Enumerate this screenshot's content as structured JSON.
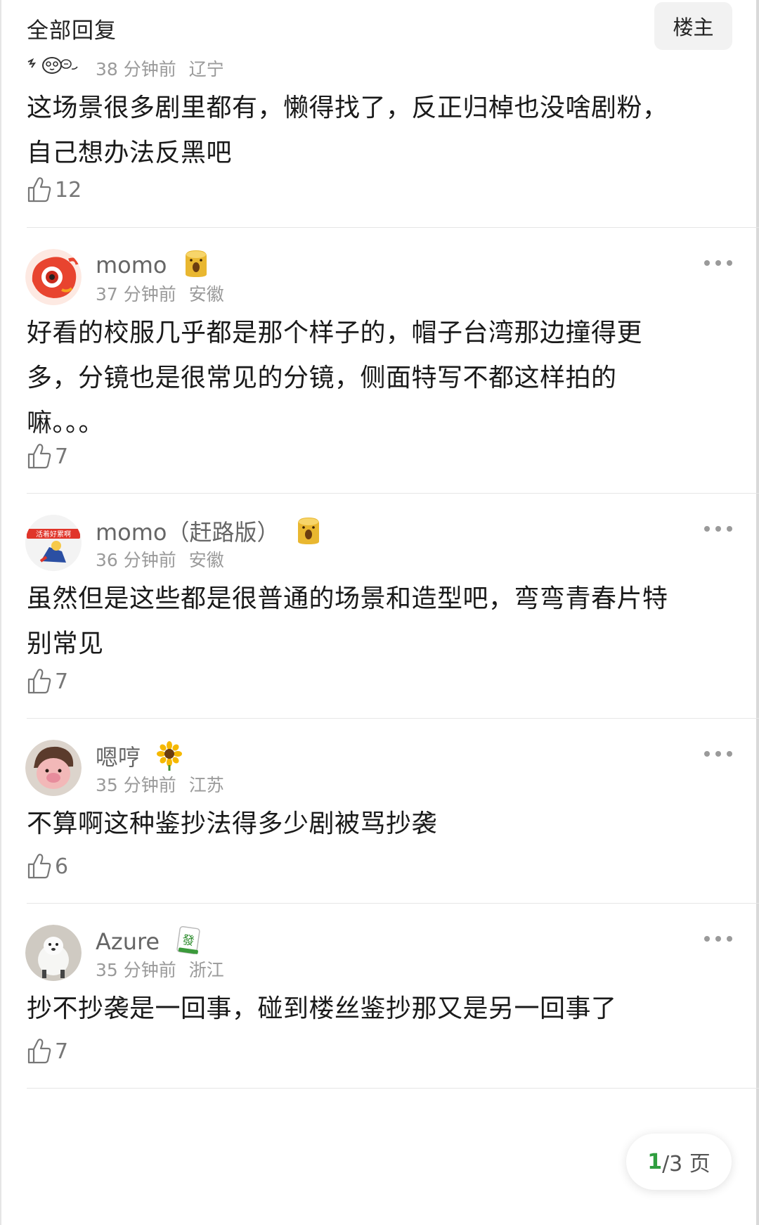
{
  "header": {
    "title": "全部回复",
    "op_button": "楼主"
  },
  "comments": [
    {
      "username": "",
      "time": "38 分钟前",
      "region": "辽宁",
      "content_lines": [
        "这场景很多剧里都有，懒得找了，反正归棹也没啥剧粉，",
        "自己想办法反黑吧"
      ],
      "likes": "12"
    },
    {
      "username": "momo",
      "time": "37 分钟前",
      "region": "安徽",
      "content_lines": [
        "好看的校服几乎都是那个样子的，帽子台湾那边撞得更",
        "多，分镜也是很常见的分镜，侧面特写不都这样拍的",
        "嘛。。。"
      ],
      "likes": "7"
    },
    {
      "username": "momo（赶路版）",
      "avatar_text": "活着好累啊",
      "time": "36 分钟前",
      "region": "安徽",
      "content_lines": [
        "虽然但是这些都是很普通的场景和造型吧，弯弯青春片特",
        "别常见"
      ],
      "likes": "7"
    },
    {
      "username": "嗯哼",
      "time": "35 分钟前",
      "region": "江苏",
      "content_lines": [
        "不算啊这种鉴抄法得多少剧被骂抄袭"
      ],
      "likes": "6"
    },
    {
      "username": "Azure",
      "badge_text": "發",
      "time": "35 分钟前",
      "region": "浙江",
      "content_lines": [
        "抄不抄袭是一回事，碰到楼丝鉴抄那又是另一回事了"
      ],
      "likes": "7"
    }
  ],
  "pager": {
    "current": "1",
    "rest": "/3 页"
  },
  "colors": {
    "accent_green": "#2f9e3f",
    "meta_gray": "#9a9a9a",
    "username_gray": "#666666",
    "divider": "#e6e6e6"
  }
}
